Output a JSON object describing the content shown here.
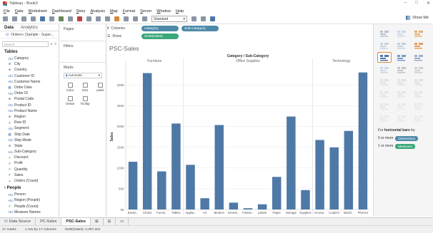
{
  "window": {
    "title": "Tableau - Book3"
  },
  "menu": [
    "File",
    "Data",
    "Worksheet",
    "Dashboard",
    "Story",
    "Analysis",
    "Map",
    "Format",
    "Server",
    "Window",
    "Help"
  ],
  "toolbar": {
    "fit": "Standard",
    "show_me": "Show Me"
  },
  "data_pane": {
    "tab_data": "Data",
    "tab_analytics": "Analytics",
    "source": "Orders+ (Sample - Super...",
    "search_placeholder": "Search",
    "tables_title": "Tables",
    "dimensions": [
      "Category",
      "City",
      "Country",
      "Customer ID",
      "Customer Name",
      "Order Date",
      "Order ID",
      "Postal Code",
      "Product ID",
      "Product Name",
      "Region",
      "Row ID",
      "Segment",
      "Ship Date",
      "Ship Mode",
      "State",
      "Sub-Category"
    ],
    "measures": [
      "Discount",
      "Profit",
      "Quantity",
      "Sales",
      "Orders (Count)"
    ],
    "people_title": "People",
    "people": [
      "Person",
      "Region (People)",
      "People (Count)"
    ],
    "cutoff": "Measure Names"
  },
  "cards": {
    "pages": "Pages",
    "filters": "Filters",
    "marks": "Marks",
    "mark_type": "Automatic",
    "buttons": [
      "Color",
      "Size",
      "Label",
      "Detail",
      "Tooltip"
    ]
  },
  "shelves": {
    "columns_label": "Columns",
    "rows_label": "Rows",
    "columns": [
      "Category",
      "Sub-Category"
    ],
    "rows": [
      "SUM(Sales)"
    ]
  },
  "showme": {
    "hint_prefix": "For",
    "hint_bold": "horizontal bars",
    "hint_suffix": "try",
    "dim_prefix": "0 or more",
    "dim_tag": "Dimensions",
    "mea_prefix": "1 or more",
    "mea_tag": "Measures"
  },
  "sheets": [
    "Data Source",
    "PC-Sales",
    "PSC-Sales"
  ],
  "status": {
    "marks": "17 marks",
    "rows": "1 row by 17 columns",
    "sum": "SUM(Sales): 2,297,201"
  },
  "chart_data": {
    "type": "bar",
    "title": "PSC-Sales",
    "header": "Category / Sub-Category",
    "ylabel": "Sales",
    "ylim": [
      0,
      350000
    ],
    "yticks": [
      "0K",
      "50K",
      "100K",
      "150K",
      "200K",
      "250K",
      "300K"
    ],
    "groups": [
      {
        "name": "Furniture",
        "categories": [
          "Bookc..",
          "Chairs",
          "Furnis..",
          "Tables"
        ],
        "values": [
          114880,
          328449,
          91705,
          206966
        ]
      },
      {
        "name": "Office Supplies",
        "categories": [
          "Applia..",
          "Art",
          "Binders",
          "Envelo..",
          "Fasten..",
          "Labels",
          "Paper",
          "Storage",
          "Supplies"
        ],
        "values": [
          107532,
          27119,
          203413,
          16476,
          3024,
          12486,
          78479,
          223844,
          46674
        ]
      },
      {
        "name": "Technology",
        "categories": [
          "Access..",
          "Copiers",
          "Machi..",
          "Phones"
        ],
        "values": [
          167380,
          149528,
          189239,
          330007
        ]
      }
    ],
    "bar_color": "#4e79a7"
  }
}
